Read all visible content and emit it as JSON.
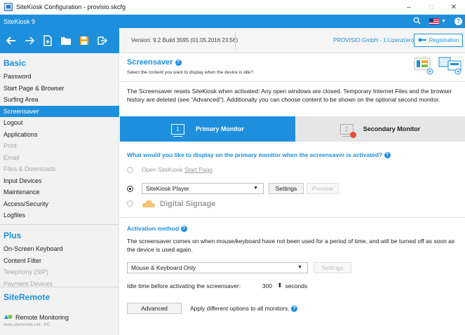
{
  "window": {
    "title": "SiteKiosk Configuration - provisio.skcfg",
    "controls": {
      "minimize": "–",
      "maximize": "□",
      "close": "✕"
    }
  },
  "appbar": {
    "name": "SiteKiosk 9",
    "icons": [
      "search-icon",
      "us-flag-icon",
      "help-icon"
    ],
    "help_label": "?"
  },
  "toolbar": {
    "icons": [
      "back-icon",
      "forward-icon",
      "new-file-icon",
      "open-folder-icon",
      "save-icon",
      "export-icon"
    ],
    "version": "Version: 9.2 Build 3595 (01.05.2016 23:56)",
    "license": "PROVISIO GmbH - 1 Lizenz(en)",
    "registration_label": "Registration"
  },
  "sidebar": {
    "basic_title": "Basic",
    "basic_items": [
      {
        "label": "Password",
        "state": "normal"
      },
      {
        "label": "Start Page & Browser",
        "state": "normal"
      },
      {
        "label": "Surfing Area",
        "state": "normal"
      },
      {
        "label": "Screensaver",
        "state": "active"
      },
      {
        "label": "Logout",
        "state": "normal"
      },
      {
        "label": "Applications",
        "state": "normal"
      },
      {
        "label": "Print",
        "state": "disabled"
      },
      {
        "label": "Email",
        "state": "disabled"
      },
      {
        "label": "Files & Downloads",
        "state": "disabled"
      },
      {
        "label": "Input Devices",
        "state": "normal"
      },
      {
        "label": "Maintenance",
        "state": "normal"
      },
      {
        "label": "Access/Security",
        "state": "normal"
      },
      {
        "label": "Logfiles",
        "state": "normal"
      }
    ],
    "plus_title": "Plus",
    "plus_items": [
      {
        "label": "On-Screen Keyboard",
        "state": "normal"
      },
      {
        "label": "Content Filter",
        "state": "normal"
      },
      {
        "label": "Telephony (SIP)",
        "state": "disabled"
      },
      {
        "label": "Payment Devices",
        "state": "disabled"
      }
    ],
    "remote_title": "SiteRemote",
    "remote_label": "Remote Monitoring",
    "remote_sub": "www.siteremote.net - PC"
  },
  "main": {
    "title": "Screensaver",
    "subtitle": "Select the content you want to display when the device is idle?",
    "description": "The Screensaver resets SiteKiosk when activated: Any open windows are closed. Temporary Internet Files and the browser history are deleted (see \"Advanced\"). Additionally you can choose content to be shown on the optional second monitor.",
    "tabs": [
      {
        "label": "Primary Monitor",
        "number": "1",
        "active": true
      },
      {
        "label": "Secondary Monitor",
        "number": "2",
        "active": false
      }
    ],
    "question": "What would you like to display on the primary monitor when the screensaver is activated?",
    "option1_prefix": "Open SiteKiosk ",
    "option1_link": "Start Page",
    "option2_select": "SiteKiosk Player",
    "settings_label": "Settings",
    "preview_label": "Preview",
    "option3_label": "Digital Signage",
    "activation_title": "Activation method",
    "activation_desc": "The screensaver comes on when mouse/keyboard have not been used for a period of time, and will be turned off as soon as the device is used again.",
    "activation_select": "Mouse & Keyboard Only",
    "activation_settings": "Settings",
    "idle_label": "Idle time before activating the screensaver:",
    "idle_value": "300",
    "idle_unit": "seconds",
    "advanced_label": "Advanced",
    "advanced_desc": "Apply different options to all monitors.",
    "info_label": "?"
  },
  "colors": {
    "accent": "#1d8fdc",
    "sidebar_bg": "#f2f2f2",
    "disabled_text": "#a8a8a8"
  }
}
